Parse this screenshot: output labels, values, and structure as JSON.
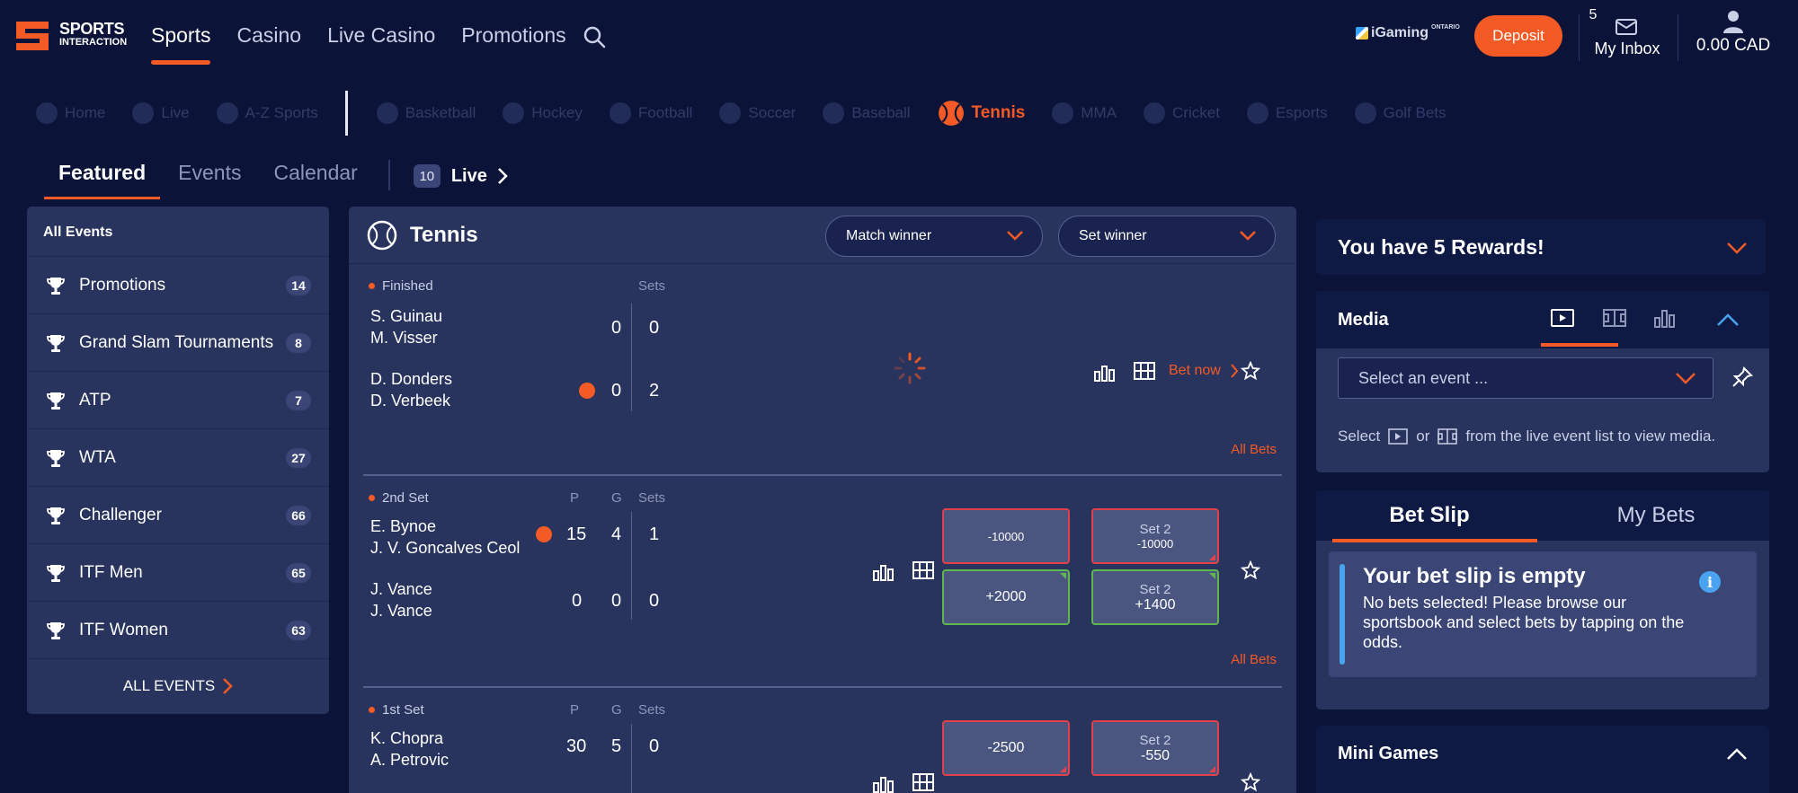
{
  "brand": {
    "line1": "SPORTS",
    "line2": "INTERACTION",
    "accent": "#f35a25"
  },
  "topnav": [
    "Sports",
    "Casino",
    "Live Casino",
    "Promotions"
  ],
  "header": {
    "igaming": "iGaming",
    "igaming_sup": "ONTARIO",
    "deposit": "Deposit",
    "inbox_label": "My Inbox",
    "inbox_count": "5",
    "balance": "0.00 CAD"
  },
  "sportsbar": {
    "items": [
      "Home",
      "Live",
      "A-Z Sports",
      "Basketball",
      "Hockey",
      "Football",
      "Soccer",
      "Baseball"
    ],
    "active": "Tennis",
    "more": [
      "MMA",
      "Cricket",
      "Esports",
      "Golf Bets"
    ]
  },
  "subtabs": {
    "items": [
      "Featured",
      "Events",
      "Calendar"
    ],
    "live_count": "10",
    "live_label": "Live"
  },
  "sidebar": {
    "header": "All Events",
    "items": [
      {
        "name": "Promotions",
        "count": "14"
      },
      {
        "name": "Grand Slam Tournaments",
        "count": "8"
      },
      {
        "name": "ATP",
        "count": "7"
      },
      {
        "name": "WTA",
        "count": "27"
      },
      {
        "name": "Challenger",
        "count": "66"
      },
      {
        "name": "ITF Men",
        "count": "65"
      },
      {
        "name": "ITF Women",
        "count": "63"
      }
    ],
    "footer": "ALL EVENTS"
  },
  "main": {
    "title": "Tennis",
    "dropdown1": "Match winner",
    "dropdown2": "Set winner",
    "all_bets": "All Bets",
    "matches": [
      {
        "status": "Finished",
        "col_sets": "Sets",
        "p1a": "S. Guinau",
        "p1b": "M. Visser",
        "p2a": "D. Donders",
        "p2b": "D. Verbeek",
        "s1": [
          "0",
          "0"
        ],
        "s2": [
          "0",
          "2"
        ],
        "bet_now": "Bet now"
      },
      {
        "status": "2nd Set",
        "col_p": "P",
        "col_g": "G",
        "col_sets": "Sets",
        "p1a": "E. Bynoe",
        "p1b": "J. V. Goncalves Ceol",
        "p2a": "J. Vance",
        "p2b": "J. Vance",
        "s1": [
          "15",
          "4",
          "1"
        ],
        "s2": [
          "0",
          "0",
          "0"
        ],
        "odds": {
          "a": "-10000",
          "b_top": "Set 2",
          "b": "-10000",
          "c": "+2000",
          "d_top": "Set 2",
          "d": "+1400"
        }
      },
      {
        "status": "1st Set",
        "col_p": "P",
        "col_g": "G",
        "col_sets": "Sets",
        "p1a": "K. Chopra",
        "p1b": "A. Petrovic",
        "s1": [
          "30",
          "5",
          "0"
        ],
        "odds": {
          "a": "-2500",
          "b_top": "Set 2",
          "b": "-550"
        }
      }
    ]
  },
  "right": {
    "rewards": "You have 5 Rewards!",
    "media_title": "Media",
    "media_select": "Select an event ...",
    "media_hint_1": "Select",
    "media_hint_or": "or",
    "media_hint_2": "from the live event list to view media.",
    "betslip_tab": "Bet Slip",
    "mybets_tab": "My Bets",
    "empty_title": "Your bet slip is empty",
    "empty_text": "No bets selected! Please browse our sportsbook and select bets by tapping on the odds.",
    "mini_games": "Mini Games"
  }
}
